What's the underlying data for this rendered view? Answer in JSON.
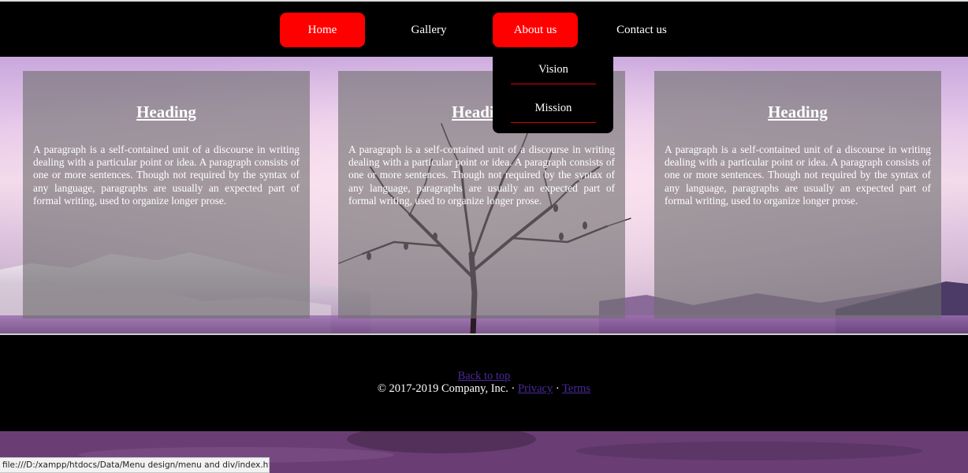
{
  "nav": {
    "items": [
      {
        "label": "Home",
        "active": true
      },
      {
        "label": "Gallery",
        "active": false
      },
      {
        "label": "About us",
        "active": true
      },
      {
        "label": "Contact us",
        "active": false
      }
    ],
    "dropdown": [
      "Vision",
      "Mission"
    ]
  },
  "cards": [
    {
      "heading": "Heading",
      "text": "A paragraph is a self-contained unit of a discourse in writing dealing with a particular point or idea. A paragraph consists of one or more sentences. Though not required by the syntax of any language, paragraphs are usually an expected part of formal writing, used to organize longer prose."
    },
    {
      "heading": "Heading",
      "text": "A paragraph is a self-contained unit of a discourse in writing dealing with a particular point or idea. A paragraph consists of one or more sentences. Though not required by the syntax of any language, paragraphs are usually an expected part of formal writing, used to organize longer prose."
    },
    {
      "heading": "Heading",
      "text": "A paragraph is a self-contained unit of a discourse in writing dealing with a particular point or idea. A paragraph consists of one or more sentences. Though not required by the syntax of any language, paragraphs are usually an expected part of formal writing, used to organize longer prose."
    }
  ],
  "footer": {
    "back_to_top": "Back to top",
    "copyright": "© 2017-2019 Company, Inc.",
    "sep1": " · ",
    "privacy": "Privacy",
    "sep2": " · ",
    "terms": "Terms"
  },
  "status_bar": {
    "url": "file:///D:/xampp/htdocs/Data/Menu design/menu and div/index.html#"
  },
  "colors": {
    "accent": "#ff0000",
    "nav_bg": "#000000",
    "link": "#4b2a9c"
  }
}
